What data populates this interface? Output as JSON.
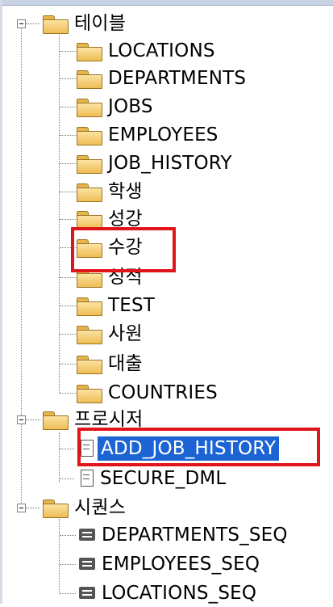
{
  "tree": {
    "tables": {
      "label": "테이블",
      "items": [
        "LOCATIONS",
        "DEPARTMENTS",
        "JOBS",
        "EMPLOYEES",
        "JOB_HISTORY",
        "학생",
        "성강",
        "수강",
        "성적",
        "TEST",
        "사원",
        "대출",
        "COUNTRIES"
      ]
    },
    "procedures": {
      "label": "프로시저",
      "items": [
        "ADD_JOB_HISTORY",
        "SECURE_DML"
      ],
      "selected": "ADD_JOB_HISTORY"
    },
    "sequences": {
      "label": "시퀀스",
      "items": [
        "DEPARTMENTS_SEQ",
        "EMPLOYEES_SEQ",
        "LOCATIONS_SEQ"
      ]
    }
  },
  "colors": {
    "highlight_box": "#e0141b",
    "selection": "#1c64d4",
    "folder": "#efbd55"
  },
  "icons": {
    "expander": "collapse-minus-icon",
    "folder": "folder-icon",
    "procedure": "procedure-icon",
    "sequence": "sequence-icon"
  }
}
